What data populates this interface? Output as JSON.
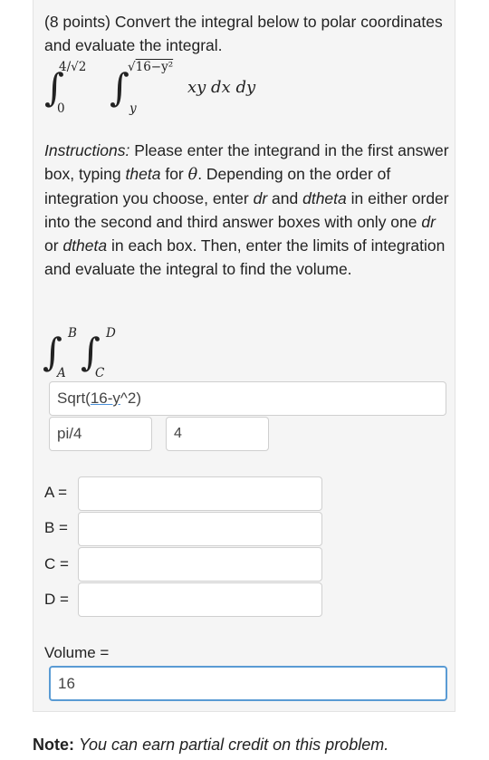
{
  "question": {
    "points": "(8 points)",
    "text": "Convert the integral below to polar coordinates and evaluate the integral."
  },
  "integral": {
    "outer_lower": "0",
    "outer_upper": "4/√2",
    "inner_lower": "y",
    "inner_upper": "16−y²",
    "integrand": "xy dx dy"
  },
  "instructions": {
    "prefix": "Instructions:",
    "p1": "Please enter the integrand in the first answer box, typing",
    "theta_word": "theta",
    "p2": "for",
    "theta_symbol": "θ",
    "p3": ". Depending on the order of integration you choose, enter",
    "dr": "dr",
    "p4": "and",
    "dtheta": "dtheta",
    "p5": "in either order into the second and third answer boxes with only one",
    "dr2": "dr",
    "p6": "or",
    "dtheta2": "dtheta",
    "p7": "in each box. Then, enter the limits of integration and evaluate the integral to find the volume."
  },
  "template_integral": {
    "B": "B",
    "A": "A",
    "D": "D",
    "C": "C"
  },
  "answers": {
    "integrand_value_a": "Sqrt(",
    "integrand_value_b": "16-y",
    "integrand_value_c": "^2)",
    "diff1_value": "pi/4",
    "diff2_value": "4",
    "A_label": "A =",
    "A_value": "",
    "B_label": "B =",
    "B_value": "",
    "C_label": "C =",
    "C_value": "",
    "D_label": "D =",
    "D_value": "",
    "volume_label": "Volume =",
    "volume_value": "16"
  },
  "note": {
    "bold": "Note:",
    "text": "You can earn partial credit on this problem."
  }
}
